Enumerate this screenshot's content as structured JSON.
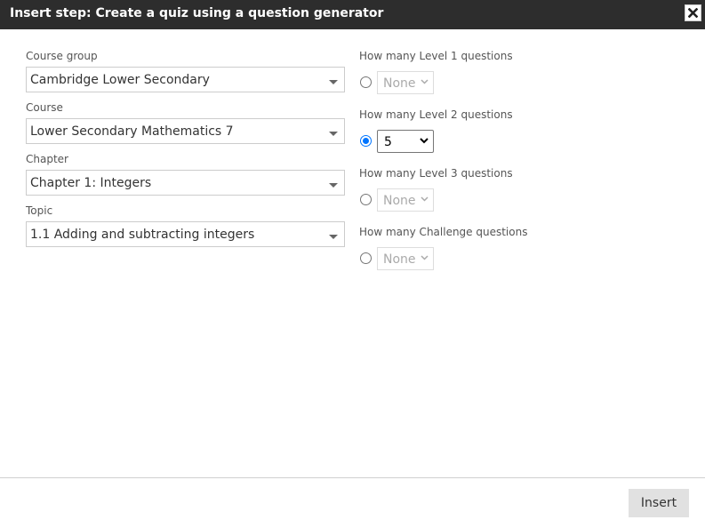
{
  "dialog": {
    "title": "Insert step: Create a quiz using a question generator"
  },
  "left": {
    "course_group": {
      "label": "Course group",
      "value": "Cambridge Lower Secondary"
    },
    "course": {
      "label": "Course",
      "value": "Lower Secondary Mathematics 7"
    },
    "chapter": {
      "label": "Chapter",
      "value": "Chapter 1: Integers"
    },
    "topic": {
      "label": "Topic",
      "value": "1.1 Adding and subtracting integers"
    }
  },
  "right": {
    "levels": [
      {
        "label": "How many Level 1 questions",
        "value": "None",
        "selected": false
      },
      {
        "label": "How many Level 2 questions",
        "value": "5",
        "selected": true
      },
      {
        "label": "How many Level 3 questions",
        "value": "None",
        "selected": false
      },
      {
        "label": "How many Challenge questions",
        "value": "None",
        "selected": false
      }
    ]
  },
  "footer": {
    "insert_label": "Insert"
  },
  "colors": {
    "titlebar": "#2d2d2d",
    "radio_accent": "#0075ff",
    "button_bg": "#e1e1e1"
  },
  "icons": {
    "close": "close-icon",
    "dropdown": "dropdown-caret-icon",
    "chevron": "chevron-down-icon"
  }
}
